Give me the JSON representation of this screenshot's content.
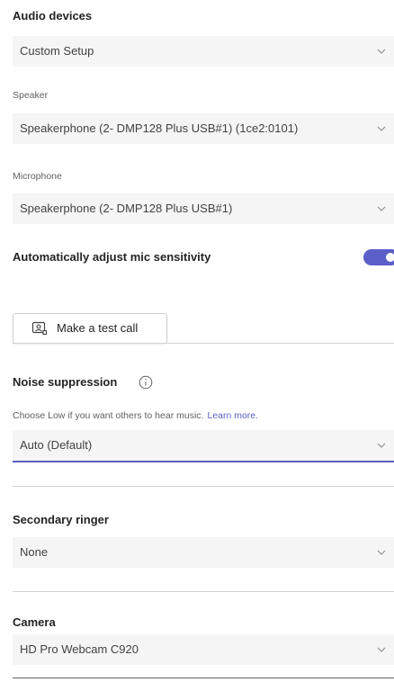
{
  "audio_devices": {
    "title": "Audio devices",
    "selected": "Custom Setup"
  },
  "speaker": {
    "label": "Speaker",
    "selected": "Speakerphone (2- DMP128 Plus USB#1) (1ce2:0101)"
  },
  "microphone": {
    "label": "Microphone",
    "selected": "Speakerphone (2- DMP128 Plus USB#1)"
  },
  "auto_adjust": {
    "label": "Automatically adjust mic sensitivity",
    "enabled": true
  },
  "test_call": {
    "label": "Make a test call"
  },
  "noise_suppression": {
    "title": "Noise suppression",
    "hint": "Choose Low if you want others to hear music.",
    "link": "Learn more.",
    "selected": "Auto (Default)"
  },
  "secondary_ringer": {
    "title": "Secondary ringer",
    "selected": "None"
  },
  "camera": {
    "title": "Camera",
    "selected": "HD Pro Webcam C920"
  },
  "colors": {
    "accent": "#5b5fc7",
    "field_bg": "#f5f5f5",
    "divider": "#d1d1d1"
  },
  "icons": {
    "dropdown": "chevron-down-icon",
    "test_call": "test-call-icon",
    "info": "info-icon"
  }
}
